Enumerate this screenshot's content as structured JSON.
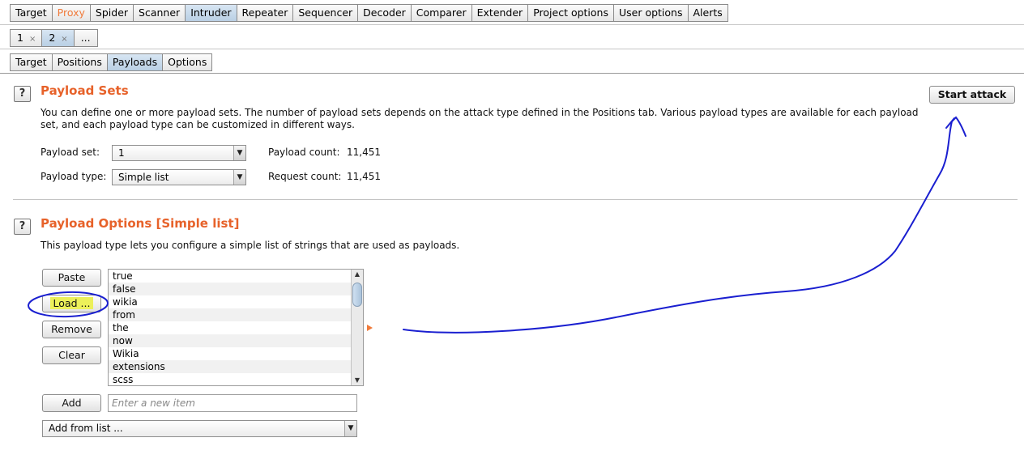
{
  "main_tabs": [
    "Target",
    "Proxy",
    "Spider",
    "Scanner",
    "Intruder",
    "Repeater",
    "Sequencer",
    "Decoder",
    "Comparer",
    "Extender",
    "Project options",
    "User options",
    "Alerts"
  ],
  "instance_tabs": [
    "1",
    "2",
    "..."
  ],
  "instance_close_glyph": "×",
  "sub_tabs": [
    "Target",
    "Positions",
    "Payloads",
    "Options"
  ],
  "help_glyph": "?",
  "payload_sets": {
    "title": "Payload Sets",
    "description_line1": "You can define one or more payload sets. The number of payload sets depends on the attack type defined in the Positions tab. Various payload types are available for each payload",
    "description_line2": "set, and each payload type can be customized in different ways.",
    "set_label": "Payload set:",
    "set_value": "1",
    "type_label": "Payload type:",
    "type_value": "Simple list",
    "payload_count_label": "Payload count:",
    "payload_count": "11,451",
    "request_count_label": "Request count:",
    "request_count": "11,451",
    "start_attack": "Start attack"
  },
  "payload_options": {
    "title": "Payload Options [Simple list]",
    "description": "This payload type lets you configure a simple list of strings that are used as payloads.",
    "buttons": {
      "paste": "Paste",
      "load": "Load ...",
      "remove": "Remove",
      "clear": "Clear",
      "add": "Add"
    },
    "list_items": [
      "true",
      "false",
      "wikia",
      "from",
      "the",
      "now",
      "Wikia",
      "extensions",
      "scss"
    ],
    "new_item_placeholder": "Enter a new item",
    "add_from_list": "Add from list ..."
  },
  "colors": {
    "accent": "#e7622a",
    "annotation": "#1a1fd0",
    "highlight": "#ecf05a"
  }
}
